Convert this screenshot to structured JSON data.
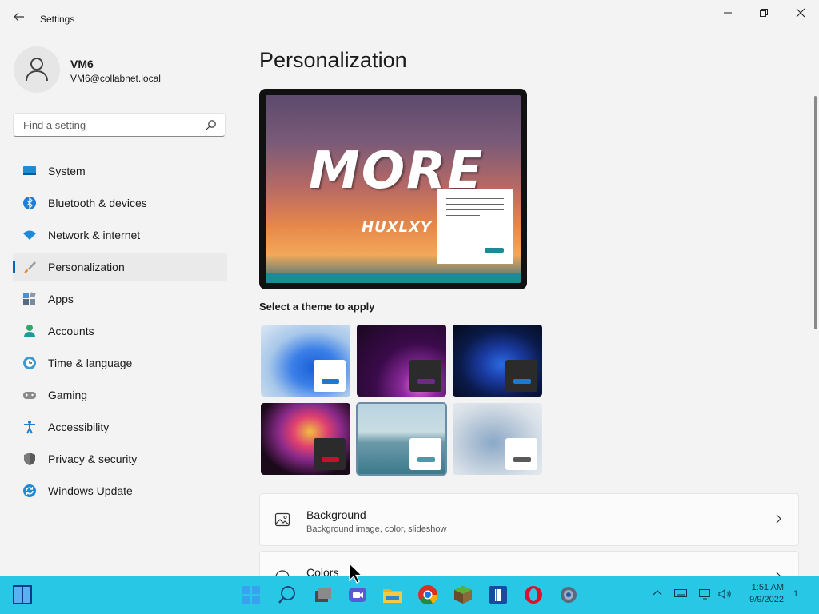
{
  "window": {
    "title": "Settings",
    "back_icon": "back-arrow-icon",
    "minimize_label": "—",
    "maximize_label": "❐",
    "close_label": "✕"
  },
  "user": {
    "name": "VM6",
    "email": "VM6@collabnet.local"
  },
  "search": {
    "placeholder": "Find a setting"
  },
  "nav": {
    "items": [
      {
        "label": "System",
        "icon": "system-icon"
      },
      {
        "label": "Bluetooth & devices",
        "icon": "bluetooth-icon"
      },
      {
        "label": "Network & internet",
        "icon": "wifi-icon"
      },
      {
        "label": "Personalization",
        "icon": "paintbrush-icon",
        "active": true
      },
      {
        "label": "Apps",
        "icon": "apps-icon"
      },
      {
        "label": "Accounts",
        "icon": "accounts-icon"
      },
      {
        "label": "Time & language",
        "icon": "clock-globe-icon"
      },
      {
        "label": "Gaming",
        "icon": "gamepad-icon"
      },
      {
        "label": "Accessibility",
        "icon": "accessibility-icon"
      },
      {
        "label": "Privacy & security",
        "icon": "shield-icon"
      },
      {
        "label": "Windows Update",
        "icon": "update-icon"
      }
    ]
  },
  "main": {
    "title": "Personalization",
    "preview": {
      "wallpaper_text": "MORE",
      "wallpaper_subtext": "HUXLXY"
    },
    "theme_label": "Select a theme to apply",
    "themes": [
      {
        "name": "windows-light",
        "accent": "#1c7ad0",
        "mini_bg": "#ffffff"
      },
      {
        "name": "glow",
        "accent": "#6a2a8a",
        "mini_bg": "#2b2b2b"
      },
      {
        "name": "windows-dark",
        "accent": "#1c7ad0",
        "mini_bg": "#2b2b2b"
      },
      {
        "name": "captured-motion",
        "accent": "#c8102e",
        "mini_bg": "#2b2b2b"
      },
      {
        "name": "sunrise",
        "accent": "#4a98a8",
        "mini_bg": "#ffffff",
        "selected": true
      },
      {
        "name": "flow",
        "accent": "#5a5a5a",
        "mini_bg": "#ffffff"
      }
    ],
    "cards": [
      {
        "title": "Background",
        "subtitle": "Background image, color, slideshow",
        "icon": "picture-icon"
      },
      {
        "title": "Colors",
        "subtitle": "",
        "icon": "palette-icon"
      }
    ]
  },
  "taskbar": {
    "clock_time": "1:51 AM",
    "clock_date": "9/9/2022",
    "notification_count": "1",
    "apps": [
      "start-icon",
      "windows-logo-icon",
      "search-icon",
      "task-view-icon",
      "chat-icon",
      "file-explorer-icon",
      "chrome-icon",
      "minecraft-icon",
      "app-icon",
      "opera-icon",
      "settings-gear-icon"
    ],
    "color": "#29c7e6"
  }
}
